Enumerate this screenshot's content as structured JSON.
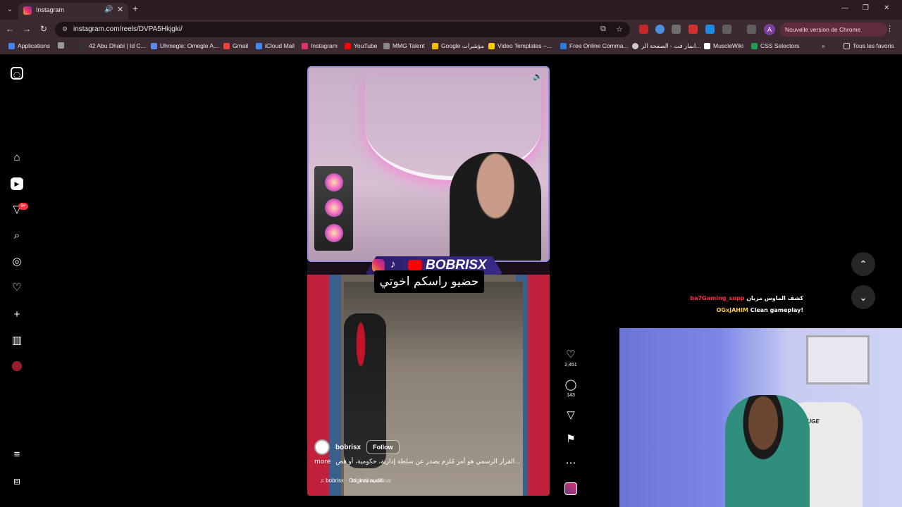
{
  "browser": {
    "tab": {
      "title": "Instagram"
    },
    "url": "instagram.com/reels/DVPA5Hkjgki/",
    "update_notice": "Nouvelle version de Chrome disponible",
    "profile_initial": "A",
    "bookmarks": [
      {
        "label": "Applications",
        "color": "#4285f4"
      },
      {
        "label": "42 Abu Dhabi | Id C...",
        "color": "#333333"
      },
      {
        "label": "Uhmegle: Omegle A...",
        "color": "#5b8def"
      },
      {
        "label": "Gmail",
        "color": "#ea4335"
      },
      {
        "label": "iCloud Mail",
        "color": "#3d8bfd"
      },
      {
        "label": "Instagram",
        "color": "#e1306c"
      },
      {
        "label": "YouTube",
        "color": "#ff0000"
      },
      {
        "label": "MMG Talent",
        "color": "#888888"
      },
      {
        "label": "Google مؤشرات",
        "color": "#fbbc05"
      },
      {
        "label": "Video Templates –...",
        "color": "#ffcc00"
      },
      {
        "label": "Free Online Comma...",
        "color": "#2a7de1"
      },
      {
        "label": "انمار فت - الصفحة الر...",
        "color": "#cccccc"
      },
      {
        "label": "MuscleWiki",
        "color": "#ffffff"
      },
      {
        "label": "CSS Selectors",
        "color": "#1f9d55"
      }
    ],
    "all_bookmarks": "Tous les favoris"
  },
  "sidebar": {
    "notifications_badge": "9+"
  },
  "reel": {
    "brand_name": "BOBRISX",
    "subtitle": "حضيو راسكم اخوتي",
    "watermark": "IG: itsfunny.official",
    "username": "bobrisx",
    "follow_label": "Follow",
    "caption_more": "more",
    "caption": "القرار الرسمي هو أمر مُلزم يصدر عن سلطة إدارية، حكومية، أو فض...",
    "audio": "bobrisx · Original audio"
  },
  "actions": {
    "likes": "2,451",
    "comments": "143"
  },
  "stream_chat": [
    {
      "user": "ba7Gaming_supp",
      "message": "كشف الماوس مزيان",
      "user_color": "#ff2a4a"
    },
    {
      "user": "OGxJAHIM",
      "message": "Clean gameplay!",
      "user_color": "#ffc83d"
    }
  ],
  "webcam": {
    "chair_label": "OUGE"
  }
}
